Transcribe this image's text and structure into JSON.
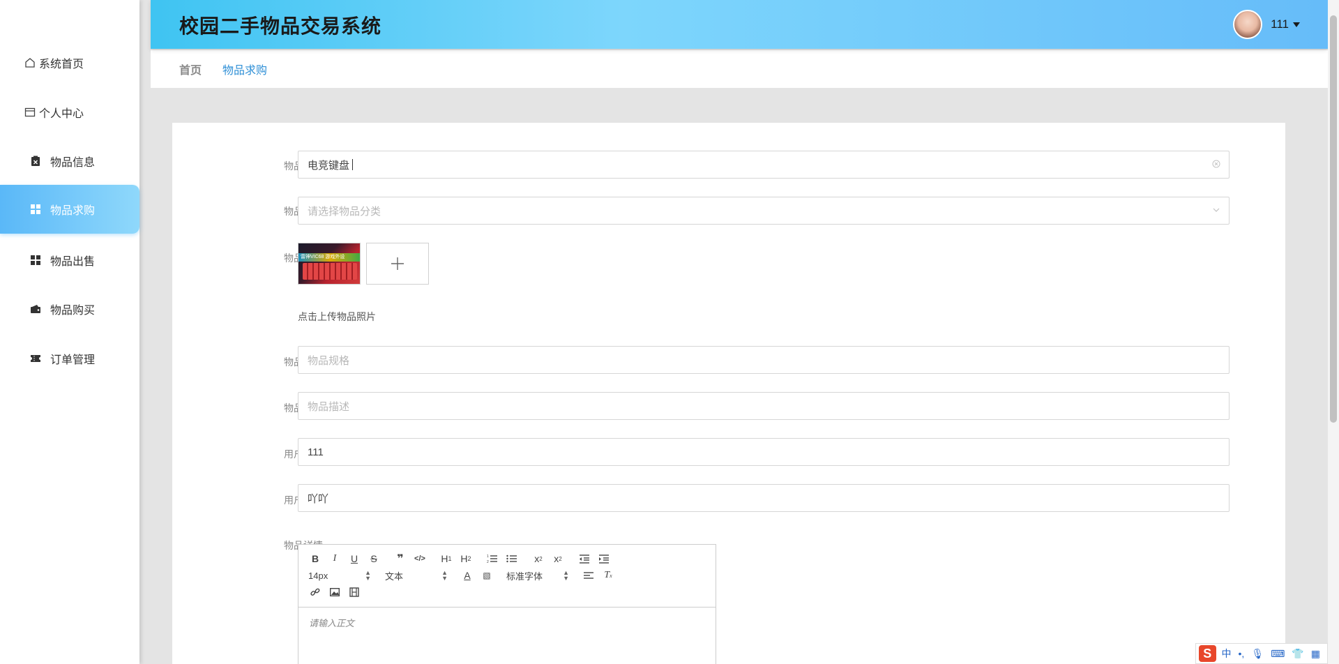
{
  "app": {
    "title": "校园二手物品交易系统"
  },
  "user": {
    "name": "111"
  },
  "sidebar": {
    "items": [
      {
        "label": "系统首页",
        "icon": "home-icon"
      },
      {
        "label": "个人中心",
        "icon": "wallet-icon"
      },
      {
        "label": "物品信息",
        "icon": "clipboard-icon"
      },
      {
        "label": "物品求购",
        "icon": "grid-icon",
        "active": true
      },
      {
        "label": "物品出售",
        "icon": "grid-icon"
      },
      {
        "label": "物品购买",
        "icon": "purse-icon"
      },
      {
        "label": "订单管理",
        "icon": "ticket-icon"
      }
    ]
  },
  "breadcrumb": {
    "home": "首页",
    "current": "物品求购"
  },
  "form": {
    "name": {
      "label": "物品名称",
      "value": "电竞键盘"
    },
    "category": {
      "label": "物品分类",
      "placeholder": "请选择物品分类"
    },
    "photo": {
      "label": "物品照片",
      "hint": "点击上传物品照片",
      "thumb_caption": "雷神VIC68 游戏外设"
    },
    "spec": {
      "label": "物品规格",
      "placeholder": "物品规格"
    },
    "desc": {
      "label": "物品描述",
      "placeholder": "物品描述"
    },
    "account": {
      "label": "用户账号",
      "value": "111"
    },
    "username": {
      "label": "用户姓名",
      "value": "吖吖"
    },
    "detail": {
      "label": "物品详情",
      "placeholder": "请输入正文"
    }
  },
  "editor": {
    "font_size": "14px",
    "block_type": "文本",
    "font_family": "标准字体"
  },
  "ime": {
    "mode": "中"
  },
  "colors": {
    "accent": "#5ab8f8",
    "breadcrumb_active": "#2e8fd6",
    "header_start": "#3fc4f2",
    "header_end": "#66bcf9"
  }
}
